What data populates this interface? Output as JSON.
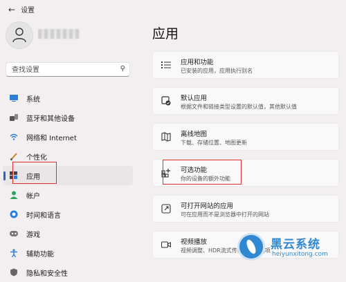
{
  "window": {
    "title": "设置"
  },
  "search": {
    "placeholder": "查找设置"
  },
  "nav": {
    "items": [
      {
        "label": "系统",
        "icon": "monitor-icon"
      },
      {
        "label": "蓝牙和其他设备",
        "icon": "bluetooth-icon"
      },
      {
        "label": "网络和 Internet",
        "icon": "wifi-icon"
      },
      {
        "label": "个性化",
        "icon": "brush-icon"
      },
      {
        "label": "应用",
        "icon": "apps-icon",
        "selected": true
      },
      {
        "label": "帐户",
        "icon": "person-icon"
      },
      {
        "label": "时间和语言",
        "icon": "globe-clock-icon"
      },
      {
        "label": "游戏",
        "icon": "gamepad-icon"
      },
      {
        "label": "辅助功能",
        "icon": "accessibility-icon"
      },
      {
        "label": "隐私和安全性",
        "icon": "shield-icon"
      }
    ]
  },
  "main": {
    "title": "应用",
    "cards": [
      {
        "title": "应用和功能",
        "desc": "已安装的应用，应用执行别名",
        "icon": "list-icon"
      },
      {
        "title": "默认应用",
        "desc": "根据文件和链接类型设置的默认值，其他默认值",
        "icon": "default-app-icon"
      },
      {
        "title": "离线地图",
        "desc": "下载、存储位置、地图更新",
        "icon": "map-icon"
      },
      {
        "title": "可选功能",
        "desc": "你的设备的额外功能",
        "icon": "add-features-icon"
      },
      {
        "title": "可打开网站的应用",
        "desc": "可在应用而不是浏览器中打开的网站",
        "icon": "open-link-icon"
      },
      {
        "title": "视频播放",
        "desc": "视频调整、HDR流式传输、电池选项",
        "icon": "video-icon"
      }
    ]
  },
  "watermark": {
    "title": "黑云系统",
    "url": "heiyunxitong.com"
  },
  "colors": {
    "accent": "#2a64c5",
    "highlight": "#e0312c",
    "watermark": "#2f88d1"
  }
}
